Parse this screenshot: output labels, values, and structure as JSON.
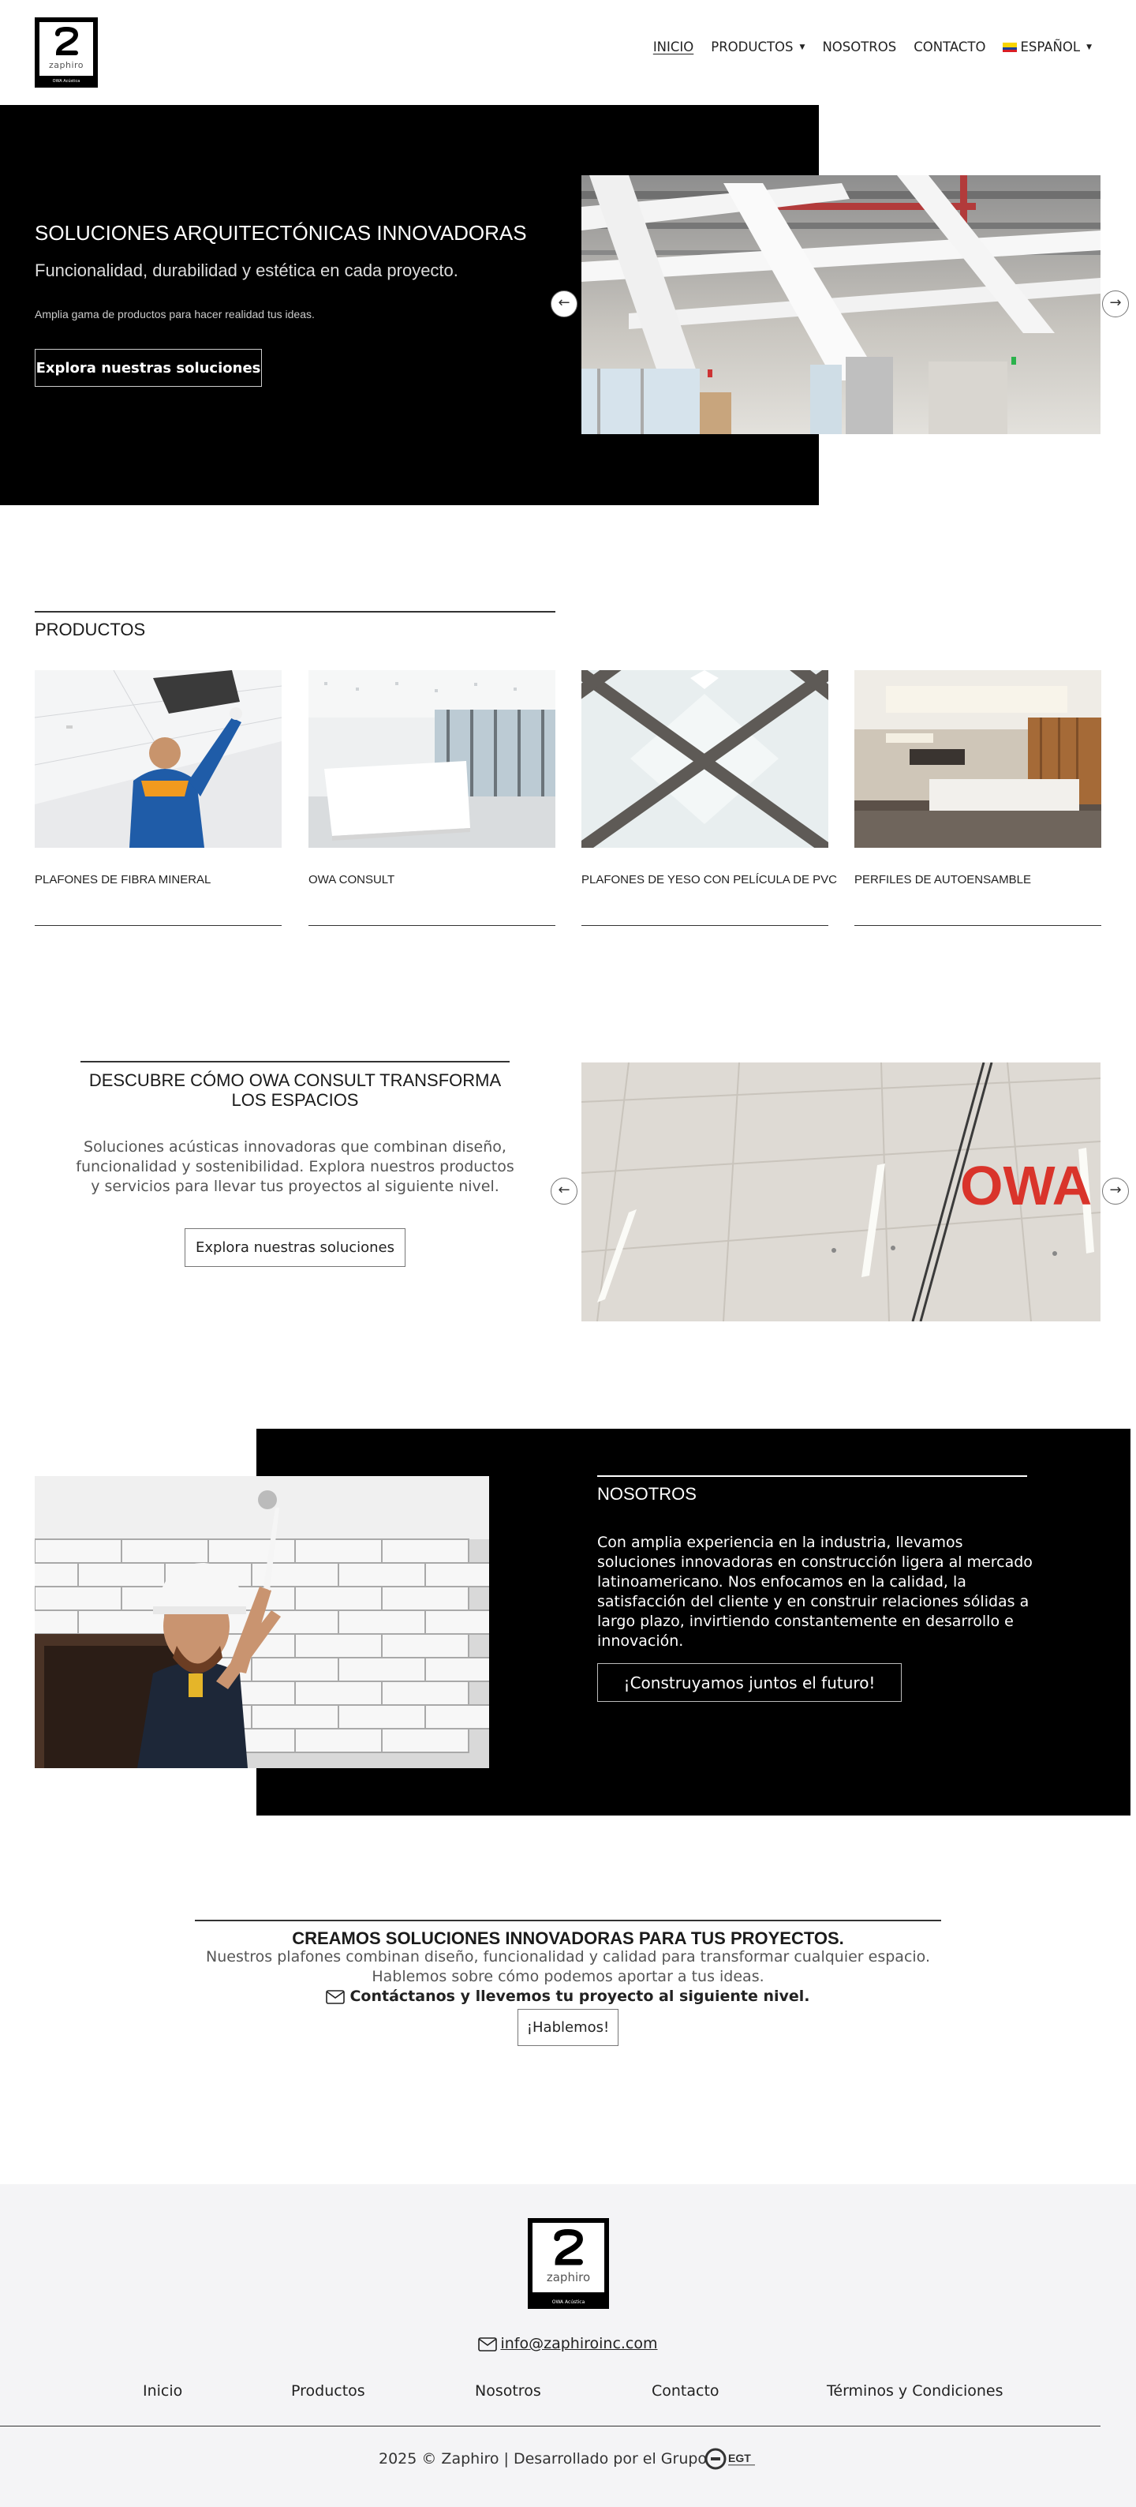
{
  "header": {
    "logo": {
      "brand": "zaphiro",
      "tagline": "OWA Acústica"
    },
    "nav": [
      {
        "label": "INICIO",
        "active": true,
        "dropdown": false
      },
      {
        "label": "PRODUCTOS",
        "active": false,
        "dropdown": true
      },
      {
        "label": "NOSOTROS",
        "active": false,
        "dropdown": false
      },
      {
        "label": "CONTACTO",
        "active": false,
        "dropdown": false
      }
    ],
    "language": {
      "label": "ESPAÑOL",
      "flag": "colombia-flag-icon"
    }
  },
  "hero": {
    "title": "SOLUCIONES ARQUITECTÓNICAS INNOVADORAS",
    "subtitle": "Funcionalidad, durabilidad y estética en cada proyecto.",
    "text": "Amplia gama de productos para hacer realidad tus ideas.",
    "button": "Explora nuestras soluciones",
    "prev_icon": "←",
    "next_icon": "→"
  },
  "products": {
    "heading": "PRODUCTOS",
    "items": [
      {
        "label": "PLAFONES DE FIBRA MINERAL"
      },
      {
        "label": "OWA CONSULT"
      },
      {
        "label": "PLAFONES DE YESO CON PELÍCULA DE PVC"
      },
      {
        "label": "PERFILES DE AUTOENSAMBLE"
      }
    ]
  },
  "owa": {
    "title": "DESCUBRE CÓMO OWA CONSULT TRANSFORMA LOS ESPACIOS",
    "text": "Soluciones acústicas innovadoras que combinan diseño, funcionalidad y sostenibilidad. Explora nuestros productos y servicios para llevar tus proyectos al siguiente nivel.",
    "button": "Explora nuestras soluciones",
    "image_logo": "OWA",
    "prev_icon": "←",
    "next_icon": "→"
  },
  "about": {
    "title": "NOSOTROS",
    "text": "Con amplia experiencia en la industria, llevamos soluciones innovadoras en construcción ligera al mercado latinoamericano. Nos enfocamos en la calidad, la satisfacción del cliente y en construir relaciones sólidas a largo plazo, invirtiendo constantemente en desarrollo e innovación.",
    "button": "¡Construyamos juntos el futuro!"
  },
  "cta": {
    "title": "CREAMOS SOLUCIONES INNOVADORAS PARA TUS PROYECTOS.",
    "line1": "Nuestros plafones combinan diseño, funcionalidad y calidad para transformar cualquier espacio.",
    "line2": "Hablemos sobre cómo podemos aportar a tus ideas.",
    "line3": "Contáctanos y llevemos tu proyecto al siguiente nivel.",
    "button": "¡Hablemos!"
  },
  "footer": {
    "logo": {
      "brand": "zaphiro",
      "tagline": "OWA Acústica"
    },
    "email": "info@zaphiroinc.com",
    "links": [
      "Inicio",
      "Productos",
      "Nosotros",
      "Contacto",
      "Términos y Condiciones"
    ],
    "copyright": "2025 © Zaphiro | Desarrollado por el Grupo",
    "dev_logo": "EGT"
  },
  "colors": {
    "black": "#000000",
    "white": "#ffffff",
    "footer_bg": "#f4f4f6",
    "owa_red": "#d9342b"
  }
}
